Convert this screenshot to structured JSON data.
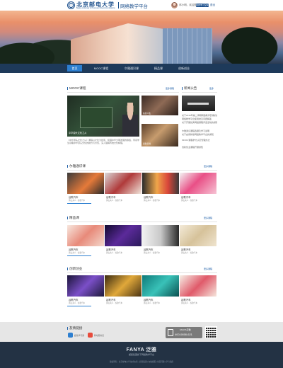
{
  "header": {
    "logo_cn": "北京邮电大学",
    "logo_en": "Beijing University of Posts and Telecommunications",
    "platform_name": "网络教学平台",
    "user_name": "邓小明，欢迎您",
    "space_button": "我的学习空间",
    "logout": "退出"
  },
  "nav": {
    "items": [
      {
        "label": "首页",
        "active": true
      },
      {
        "label": "MOOC课程",
        "active": false
      },
      {
        "label": "尔雅通识课",
        "active": false
      },
      {
        "label": "精品课",
        "active": false
      },
      {
        "label": "创新创业",
        "active": false
      }
    ]
  },
  "mooc": {
    "title": "MOOC课程",
    "more": "更多课程",
    "featured_caption": "中华源头文化之从",
    "featured_desc": "《中华源头文化之从》课程以文化为线索，梳理中华文明发展的脉络，带领学生领略中华源头文化的魅力与价值，深入理解传统文化精髓。",
    "thumbs": [
      {
        "caption": "失意人生"
      },
      {
        "caption": "春秋奇书"
      }
    ]
  },
  "notice": {
    "title": "新闻公告",
    "more": "更多",
    "items": [
      "关于2016年第二学期网络教学安排的通知",
      "网络教学平台使用常见问题解答",
      "关于开展优秀网络课程评选活动的通知",
      "尔雅通识课程选课及学习说明",
      "关于启用新版网络教学平台的通知",
      "MOOC课程学分认定管理办法",
      "创新创业课程开课通知"
    ]
  },
  "erya": {
    "title": "尔雅通识课",
    "more": "更多课程",
    "cards": [
      {
        "title": "谷歌汽车",
        "sub": "黄山夫人 · 谷歌汽车"
      },
      {
        "title": "谷歌汽车",
        "sub": "黄山夫人 · 谷歌汽车"
      },
      {
        "title": "谷歌汽车",
        "sub": "黄山夫人 · 谷歌汽车"
      },
      {
        "title": "谷歌汽车",
        "sub": "黄山夫人 · 谷歌汽车"
      }
    ]
  },
  "jingpin": {
    "title": "精品课",
    "more": "更多课程",
    "cards": [
      {
        "title": "谷歌汽车",
        "sub": "黄山夫人 · 谷歌汽车"
      },
      {
        "title": "谷歌汽车",
        "sub": "黄山夫人 · 谷歌汽车"
      },
      {
        "title": "谷歌汽车",
        "sub": "黄山夫人 · 谷歌汽车"
      },
      {
        "title": "谷歌汽车",
        "sub": "黄山夫人 · 谷歌汽车"
      }
    ]
  },
  "chuangxin": {
    "title": "创新创业",
    "more": "更多课程",
    "cards": [
      {
        "title": "谷歌汽车",
        "sub": "黄山夫人 · 谷歌汽车"
      },
      {
        "title": "谷歌汽车",
        "sub": "黄山夫人 · 谷歌汽车"
      },
      {
        "title": "谷歌汽车",
        "sub": "黄山夫人 · 谷歌汽车"
      },
      {
        "title": "谷歌汽车",
        "sub": "黄山夫人 · 谷歌汽车"
      }
    ]
  },
  "footer": {
    "apps_title": "友情链接",
    "apps": [
      {
        "label": "超星学习通",
        "color": "#2d7fd0"
      },
      {
        "label": "移动图书馆",
        "color": "#e74c3c"
      }
    ],
    "hotline_brand": "FANYA泛雅",
    "hotline_number": "400-0658-621",
    "logo": "FANYA 泛雅",
    "sub": "超星集团旗下网络教学平台",
    "copyright": "版权所有：北京邮电大学 技术支持：超星集团 | 在线客服 | 常见问题 | 学习指南"
  }
}
